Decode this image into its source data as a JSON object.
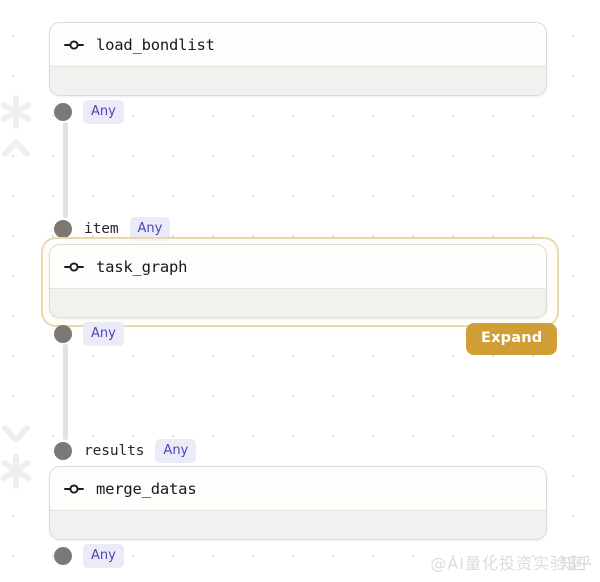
{
  "app": {
    "type": "node-graph-canvas",
    "background_color": "#ffffff",
    "grid_dot_color": "#dededf"
  },
  "colors": {
    "port_dot": "#7d7873",
    "badge_bg": "#ebeaf7",
    "badge_text": "#4a45b8",
    "card_bg": "#fdfdfc",
    "card_body_bg": "#f2f1ef",
    "card_border": "#ddd9d4",
    "selection_ring": "#e7d9ae",
    "expand_button_bg": "#d19e36",
    "expand_button_text": "#ffffff",
    "connector_line": "#e3e2e1",
    "watermark": "#d8d8d8"
  },
  "decorations": {
    "top_left": {
      "asterisk": "asterisk-icon",
      "chevron": "chevron-up-icon"
    },
    "bottom_left": {
      "chevron": "chevron-down-icon",
      "asterisk": "asterisk-icon"
    }
  },
  "nodes": [
    {
      "id": "load_bondlist",
      "title": "load_bondlist",
      "icon": "node-link-icon",
      "selected": false
    },
    {
      "id": "task_graph",
      "title": "task_graph",
      "icon": "node-link-icon",
      "selected": true
    },
    {
      "id": "merge_datas",
      "title": "merge_datas",
      "icon": "node-link-icon",
      "selected": false
    }
  ],
  "ports": [
    {
      "id": "load_bondlist_out",
      "label": "",
      "type": "Any"
    },
    {
      "id": "task_graph_in",
      "label": "item",
      "type": "Any"
    },
    {
      "id": "task_graph_out",
      "label": "",
      "type": "Any"
    },
    {
      "id": "merge_datas_in",
      "label": "results",
      "type": "Any"
    },
    {
      "id": "merge_datas_out",
      "label": "",
      "type": "Any"
    }
  ],
  "buttons": {
    "expand": "Expand"
  },
  "watermark": {
    "platform": "知乎",
    "handle": "@AI量化投资实验室"
  }
}
